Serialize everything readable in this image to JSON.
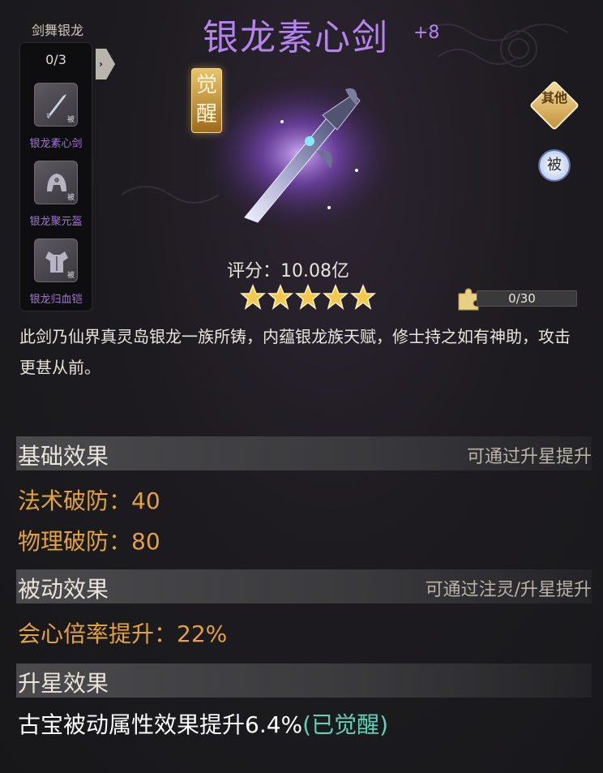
{
  "set": {
    "title": "剑舞银龙",
    "count": "0/3",
    "items": [
      {
        "label": "银龙素心剑",
        "tag": "被"
      },
      {
        "label": "银龙聚元盔",
        "tag": "被"
      },
      {
        "label": "银龙归血铠",
        "tag": "被"
      }
    ]
  },
  "item": {
    "name": "银龙素心剑",
    "level": "+8",
    "awaken_badge": "觉醒",
    "score_label": "评分：",
    "score_value": "10.08亿",
    "stars": 5,
    "description": "此剑乃仙界真灵岛银龙一族所铸，内蕴银龙族天赋，修士持之如有神助，攻击更甚从前。"
  },
  "side_buttons": {
    "other": "其他",
    "passive": "被"
  },
  "shard_progress": {
    "text": "0/30",
    "current": 0,
    "max": 30
  },
  "sections": {
    "base": {
      "title": "基础效果",
      "hint": "可通过升星提升",
      "stats": [
        "法术破防：40",
        "物理破防：80"
      ]
    },
    "passive": {
      "title": "被动效果",
      "hint": "可通过注灵/升星提升",
      "stats": [
        "会心倍率提升：22%"
      ]
    },
    "star": {
      "title": "升星效果",
      "text": "古宝被动属性效果提升6.4%",
      "status": "(已觉醒)"
    }
  },
  "colors": {
    "title_purple": "#b583ee",
    "stat_orange": "#e3a33a",
    "awakened_teal": "#5fd1b7",
    "star_gold": "#f5c74a"
  }
}
